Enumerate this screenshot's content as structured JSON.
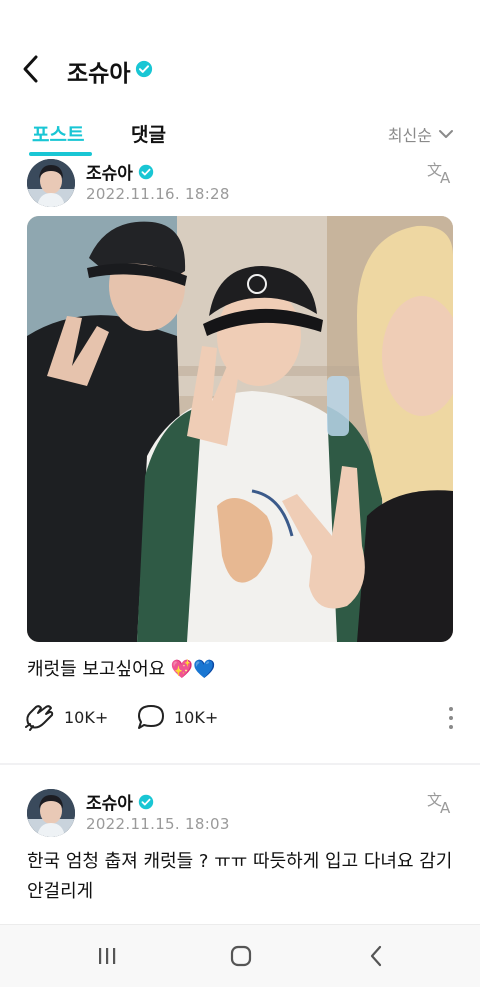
{
  "header": {
    "title": "조슈아",
    "back_icon": "chevron-left-icon",
    "verified_icon": "verified-badge-icon"
  },
  "tabs": [
    {
      "label": "포스트",
      "active": true
    },
    {
      "label": "댓글",
      "active": false
    }
  ],
  "sort": {
    "label": "최신순",
    "icon": "chevron-down-icon"
  },
  "colors": {
    "accent": "#19c6d4",
    "muted": "#9a9a9a"
  },
  "posts": [
    {
      "author": "조슈아",
      "date": "2022.11.16. 18:28",
      "translate_icon": "translate-icon",
      "text": "캐럿들 보고싶어요 💖💙",
      "likes": "10K+",
      "comments": "10K+",
      "like_icon": "cheer-icon",
      "comment_icon": "comment-bubble-icon",
      "more_icon": "more-vertical-icon"
    },
    {
      "author": "조슈아",
      "date": "2022.11.15. 18:03",
      "translate_icon": "translate-icon",
      "text": "한국 엄청 춥져 캐럿들 ? ㅠㅠ 따듯하게 입고 다녀요 감기 안걸리게"
    }
  ],
  "system_nav": {
    "recent_icon": "recent-apps-icon",
    "home_icon": "home-icon",
    "back_icon": "back-icon"
  }
}
